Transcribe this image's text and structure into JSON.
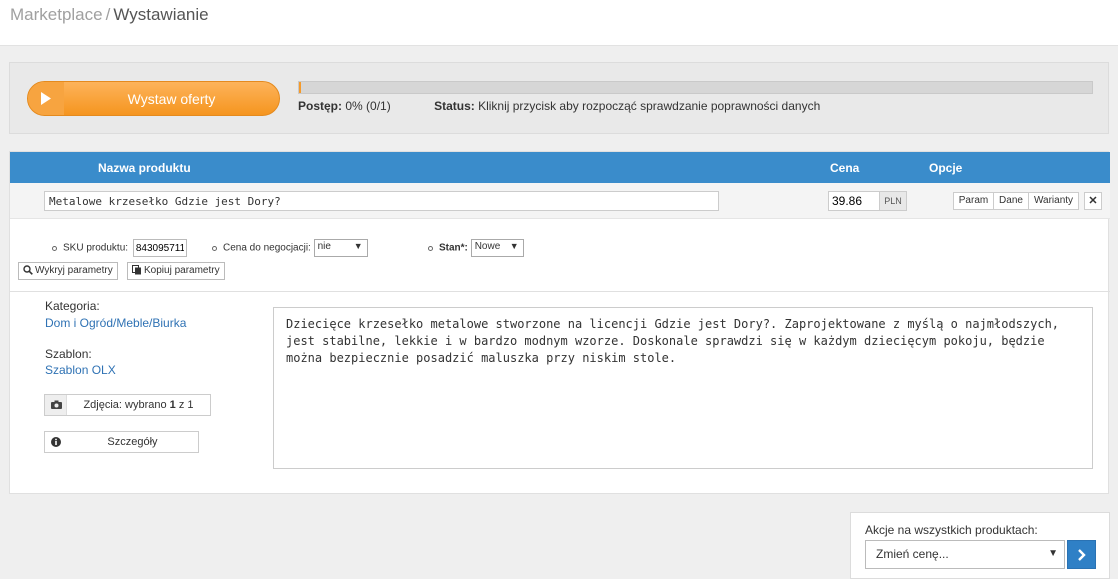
{
  "breadcrumb": {
    "root": "Marketplace",
    "separator": "/",
    "current": "Wystawianie"
  },
  "actions": {
    "start_label": "Wystaw oferty"
  },
  "progress": {
    "fraction": 0.0,
    "label": "Postęp:",
    "value": "0% (0/1)",
    "status_label": "Status:",
    "status_text": "Kliknij przycisk aby rozpocząć sprawdzanie poprawności danych"
  },
  "table": {
    "headers": {
      "name": "Nazwa produktu",
      "price": "Cena",
      "options": "Opcje"
    }
  },
  "product": {
    "name": "Metalowe krzesełko Gdzie jest Dory?",
    "price": "39.86",
    "currency": "PLN",
    "options": {
      "param": "Param",
      "data": "Dane",
      "variants": "Warianty"
    },
    "remove": "✕",
    "fields": {
      "sku_label": "SKU produktu:",
      "sku_value": "843095711",
      "negotiable_label": "Cena do negocjacji:",
      "negotiable_value": "nie",
      "condition_label": "Stan*:",
      "condition_value": "Nowe"
    },
    "tools": {
      "detect": "Wykryj parametry",
      "copy": "Kopiuj parametry"
    },
    "category_label": "Kategoria:",
    "category_value": "Dom i Ogród/Meble/Biurka",
    "template_label": "Szablon:",
    "template_value": "Szablon OLX",
    "photos": {
      "prefix": "Zdjęcia: wybrano ",
      "selected": "1",
      "middle": " z ",
      "total": "1"
    },
    "details_label": "Szczegóły",
    "description": "Dziecięce krzesełko metalowe stworzone na licencji Gdzie jest Dory?. Zaprojektowane z myślą o najmłodszych, jest stabilne, lekkie i w bardzo modnym wzorze. Doskonale sprawdzi się w każdym dziecięcym pokoju, będzie można bezpiecznie posadzić maluszka przy niskim stole."
  },
  "bulk": {
    "label": "Akcje na wszystkich produktach:",
    "selected": "Zmień cenę..."
  },
  "icons": {
    "play": "play-icon",
    "search": "search-icon",
    "copy": "copy-icon",
    "camera": "camera-icon",
    "info": "info-icon",
    "chevron": "chevron-right-icon"
  },
  "colors": {
    "accent_orange": "#f5951f",
    "header_blue": "#3a8ccb",
    "link_blue": "#2f72b4"
  }
}
